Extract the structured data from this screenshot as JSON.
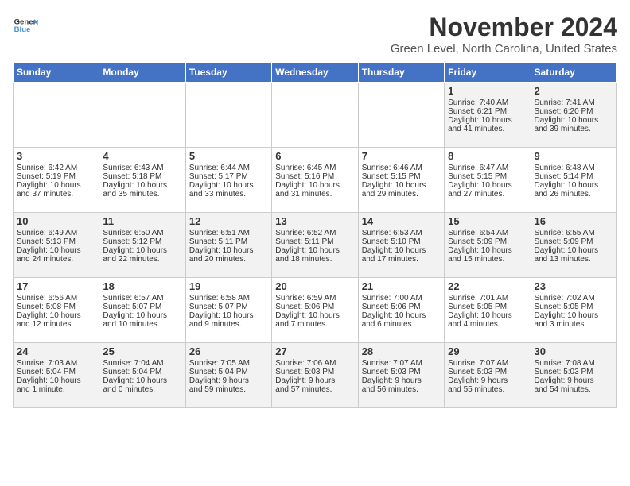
{
  "header": {
    "logo_line1": "General",
    "logo_line2": "Blue",
    "month": "November 2024",
    "location": "Green Level, North Carolina, United States"
  },
  "days_of_week": [
    "Sunday",
    "Monday",
    "Tuesday",
    "Wednesday",
    "Thursday",
    "Friday",
    "Saturday"
  ],
  "weeks": [
    [
      {
        "day": "",
        "info": ""
      },
      {
        "day": "",
        "info": ""
      },
      {
        "day": "",
        "info": ""
      },
      {
        "day": "",
        "info": ""
      },
      {
        "day": "",
        "info": ""
      },
      {
        "day": "1",
        "info": "Sunrise: 7:40 AM\nSunset: 6:21 PM\nDaylight: 10 hours\nand 41 minutes."
      },
      {
        "day": "2",
        "info": "Sunrise: 7:41 AM\nSunset: 6:20 PM\nDaylight: 10 hours\nand 39 minutes."
      }
    ],
    [
      {
        "day": "3",
        "info": "Sunrise: 6:42 AM\nSunset: 5:19 PM\nDaylight: 10 hours\nand 37 minutes."
      },
      {
        "day": "4",
        "info": "Sunrise: 6:43 AM\nSunset: 5:18 PM\nDaylight: 10 hours\nand 35 minutes."
      },
      {
        "day": "5",
        "info": "Sunrise: 6:44 AM\nSunset: 5:17 PM\nDaylight: 10 hours\nand 33 minutes."
      },
      {
        "day": "6",
        "info": "Sunrise: 6:45 AM\nSunset: 5:16 PM\nDaylight: 10 hours\nand 31 minutes."
      },
      {
        "day": "7",
        "info": "Sunrise: 6:46 AM\nSunset: 5:15 PM\nDaylight: 10 hours\nand 29 minutes."
      },
      {
        "day": "8",
        "info": "Sunrise: 6:47 AM\nSunset: 5:15 PM\nDaylight: 10 hours\nand 27 minutes."
      },
      {
        "day": "9",
        "info": "Sunrise: 6:48 AM\nSunset: 5:14 PM\nDaylight: 10 hours\nand 26 minutes."
      }
    ],
    [
      {
        "day": "10",
        "info": "Sunrise: 6:49 AM\nSunset: 5:13 PM\nDaylight: 10 hours\nand 24 minutes."
      },
      {
        "day": "11",
        "info": "Sunrise: 6:50 AM\nSunset: 5:12 PM\nDaylight: 10 hours\nand 22 minutes."
      },
      {
        "day": "12",
        "info": "Sunrise: 6:51 AM\nSunset: 5:11 PM\nDaylight: 10 hours\nand 20 minutes."
      },
      {
        "day": "13",
        "info": "Sunrise: 6:52 AM\nSunset: 5:11 PM\nDaylight: 10 hours\nand 18 minutes."
      },
      {
        "day": "14",
        "info": "Sunrise: 6:53 AM\nSunset: 5:10 PM\nDaylight: 10 hours\nand 17 minutes."
      },
      {
        "day": "15",
        "info": "Sunrise: 6:54 AM\nSunset: 5:09 PM\nDaylight: 10 hours\nand 15 minutes."
      },
      {
        "day": "16",
        "info": "Sunrise: 6:55 AM\nSunset: 5:09 PM\nDaylight: 10 hours\nand 13 minutes."
      }
    ],
    [
      {
        "day": "17",
        "info": "Sunrise: 6:56 AM\nSunset: 5:08 PM\nDaylight: 10 hours\nand 12 minutes."
      },
      {
        "day": "18",
        "info": "Sunrise: 6:57 AM\nSunset: 5:07 PM\nDaylight: 10 hours\nand 10 minutes."
      },
      {
        "day": "19",
        "info": "Sunrise: 6:58 AM\nSunset: 5:07 PM\nDaylight: 10 hours\nand 9 minutes."
      },
      {
        "day": "20",
        "info": "Sunrise: 6:59 AM\nSunset: 5:06 PM\nDaylight: 10 hours\nand 7 minutes."
      },
      {
        "day": "21",
        "info": "Sunrise: 7:00 AM\nSunset: 5:06 PM\nDaylight: 10 hours\nand 6 minutes."
      },
      {
        "day": "22",
        "info": "Sunrise: 7:01 AM\nSunset: 5:05 PM\nDaylight: 10 hours\nand 4 minutes."
      },
      {
        "day": "23",
        "info": "Sunrise: 7:02 AM\nSunset: 5:05 PM\nDaylight: 10 hours\nand 3 minutes."
      }
    ],
    [
      {
        "day": "24",
        "info": "Sunrise: 7:03 AM\nSunset: 5:04 PM\nDaylight: 10 hours\nand 1 minute."
      },
      {
        "day": "25",
        "info": "Sunrise: 7:04 AM\nSunset: 5:04 PM\nDaylight: 10 hours\nand 0 minutes."
      },
      {
        "day": "26",
        "info": "Sunrise: 7:05 AM\nSunset: 5:04 PM\nDaylight: 9 hours\nand 59 minutes."
      },
      {
        "day": "27",
        "info": "Sunrise: 7:06 AM\nSunset: 5:03 PM\nDaylight: 9 hours\nand 57 minutes."
      },
      {
        "day": "28",
        "info": "Sunrise: 7:07 AM\nSunset: 5:03 PM\nDaylight: 9 hours\nand 56 minutes."
      },
      {
        "day": "29",
        "info": "Sunrise: 7:07 AM\nSunset: 5:03 PM\nDaylight: 9 hours\nand 55 minutes."
      },
      {
        "day": "30",
        "info": "Sunrise: 7:08 AM\nSunset: 5:03 PM\nDaylight: 9 hours\nand 54 minutes."
      }
    ]
  ]
}
